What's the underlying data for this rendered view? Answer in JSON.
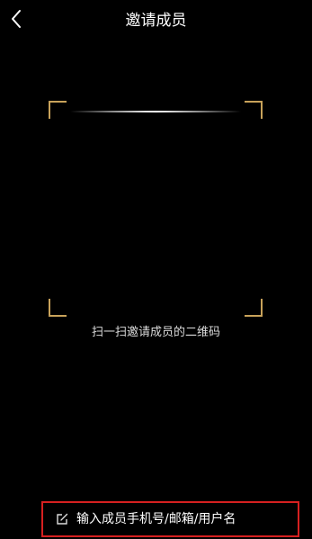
{
  "header": {
    "back_icon": "chevron-left-icon",
    "title": "邀请成员"
  },
  "scanner": {
    "hint": "扫一扫邀请成员的二维码"
  },
  "footer": {
    "icon": "edit-icon",
    "input_label": "输入成员手机号/邮箱/用户名"
  },
  "colors": {
    "background": "#000000",
    "corner_accent": "#c8a25a",
    "highlight_border": "#d62020",
    "text": "#ffffff"
  }
}
